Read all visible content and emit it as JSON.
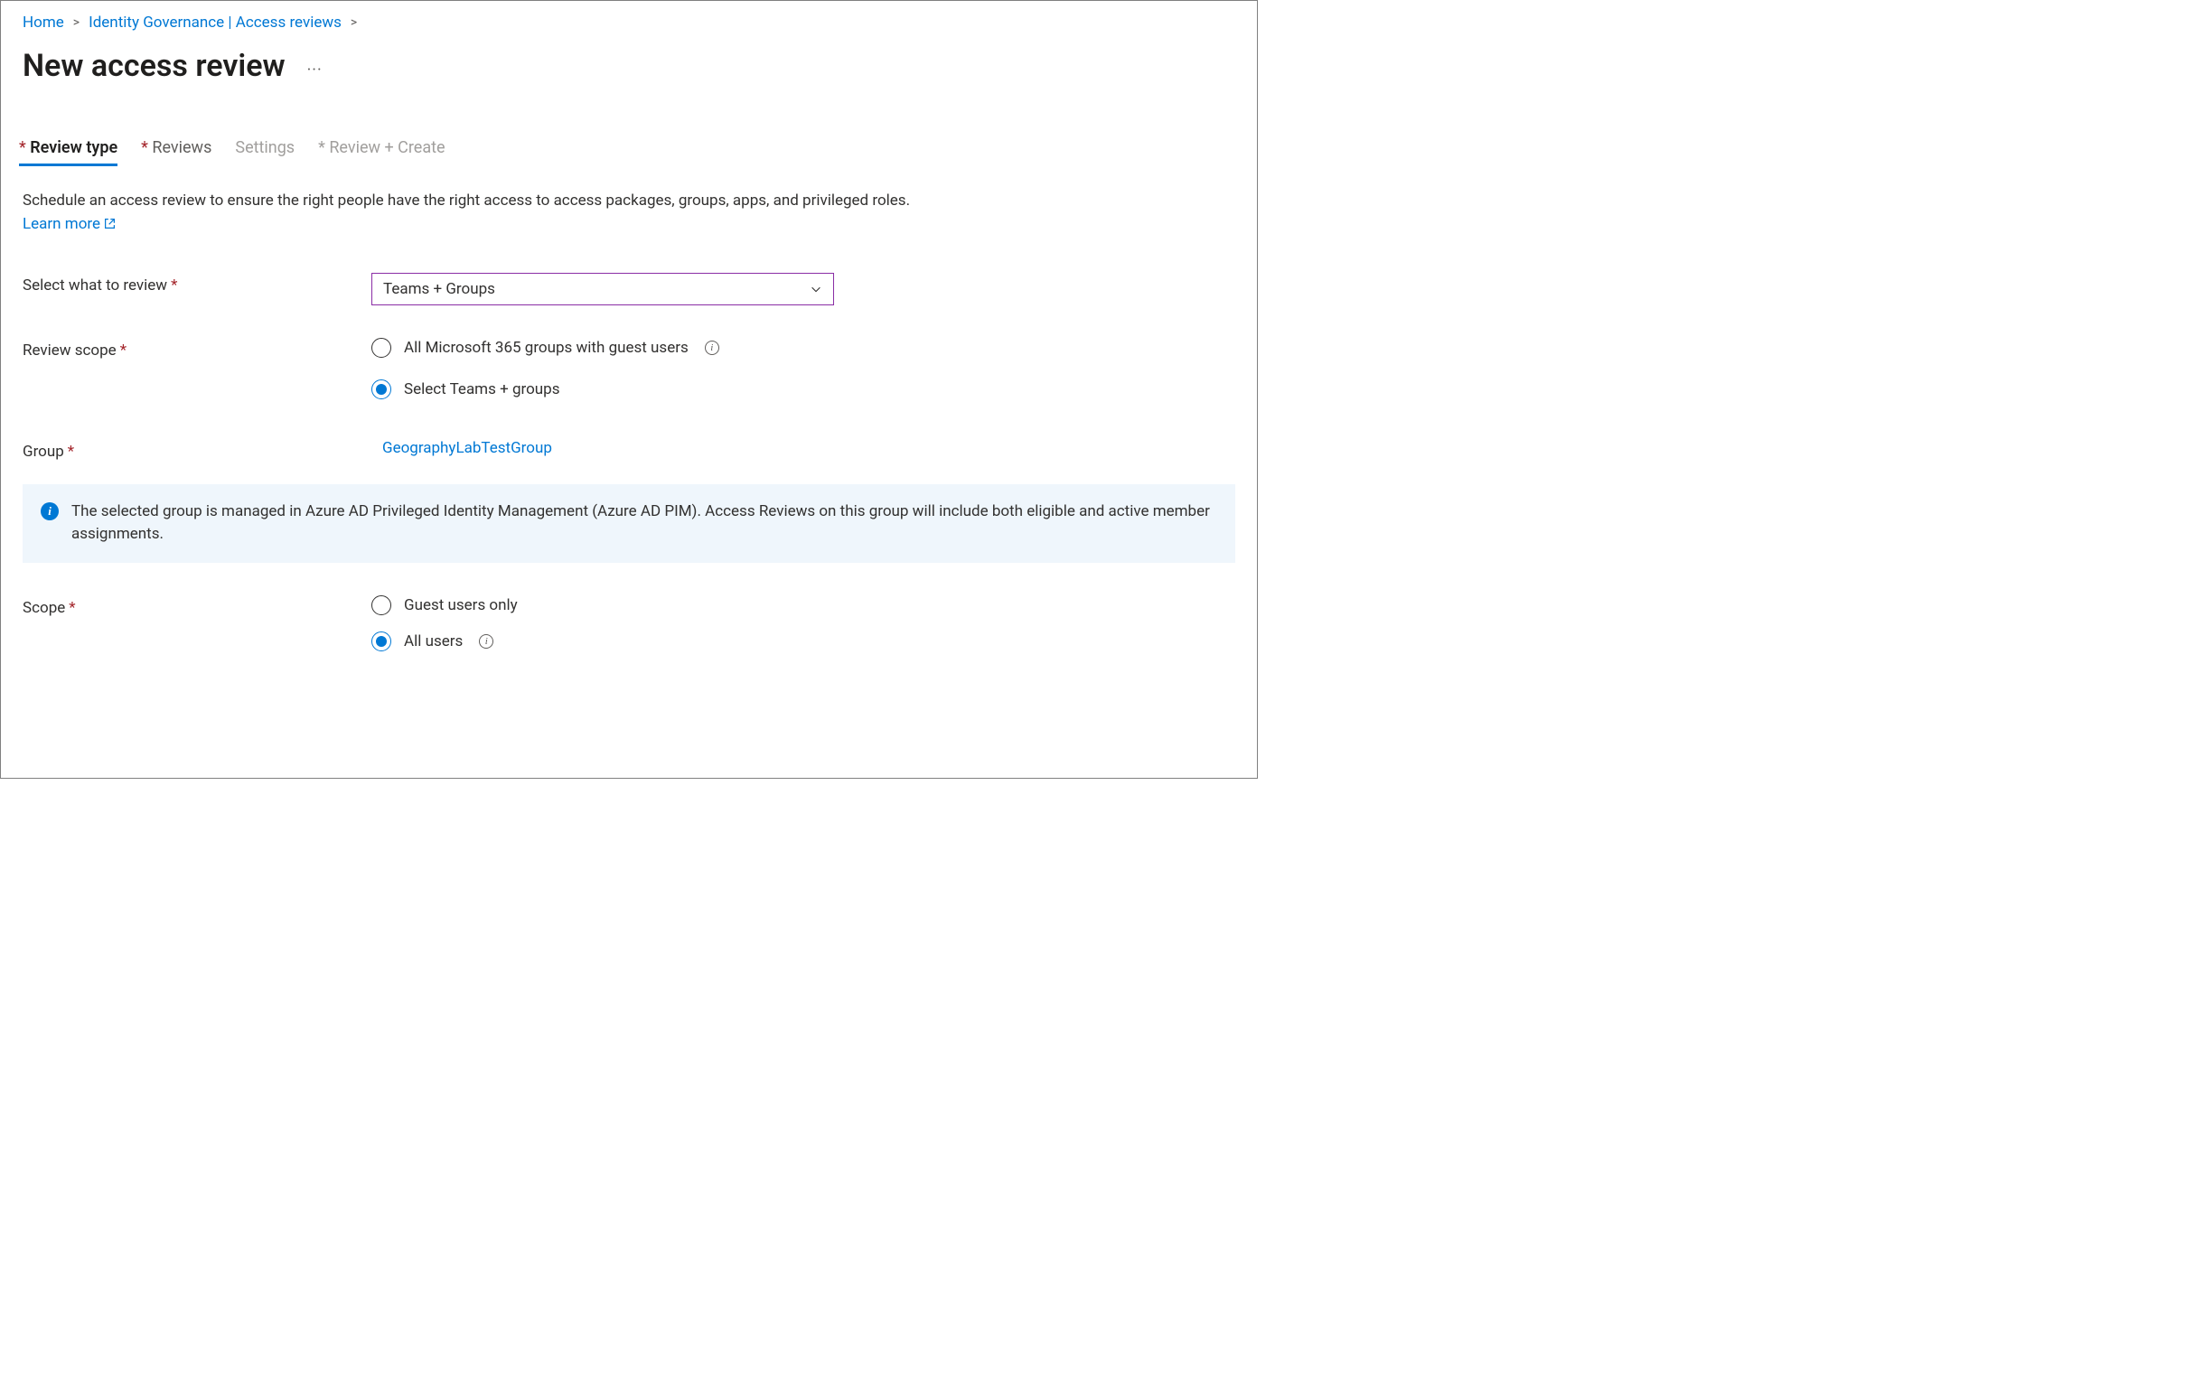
{
  "breadcrumb": {
    "items": [
      {
        "label": "Home"
      },
      {
        "label": "Identity Governance | Access reviews"
      }
    ]
  },
  "pageTitle": "New access review",
  "tabs": [
    {
      "label": "Review type",
      "active": true,
      "required": true
    },
    {
      "label": "Reviews",
      "active": false,
      "required": true
    },
    {
      "label": "Settings",
      "active": false,
      "required": false,
      "disabled": true
    },
    {
      "label": "Review + Create",
      "active": false,
      "required": true,
      "disabled": true
    }
  ],
  "intro": {
    "text": "Schedule an access review to ensure the right people have the right access to access packages, groups, apps, and privileged roles.",
    "learnMore": "Learn more"
  },
  "form": {
    "selectWhatToReview": {
      "label": "Select what to review",
      "value": "Teams + Groups"
    },
    "reviewScope": {
      "label": "Review scope",
      "options": [
        {
          "label": "All Microsoft 365 groups with guest users",
          "selected": false,
          "hasInfo": true
        },
        {
          "label": "Select Teams + groups",
          "selected": true,
          "hasInfo": false
        }
      ]
    },
    "group": {
      "label": "Group",
      "value": "GeographyLabTestGroup"
    },
    "infoBanner": "The selected group is managed in Azure AD Privileged Identity Management (Azure AD PIM). Access Reviews on this group will include both eligible and active member assignments.",
    "scope": {
      "label": "Scope",
      "options": [
        {
          "label": "Guest users only",
          "selected": false,
          "hasInfo": false
        },
        {
          "label": "All users",
          "selected": true,
          "hasInfo": true
        }
      ]
    }
  }
}
